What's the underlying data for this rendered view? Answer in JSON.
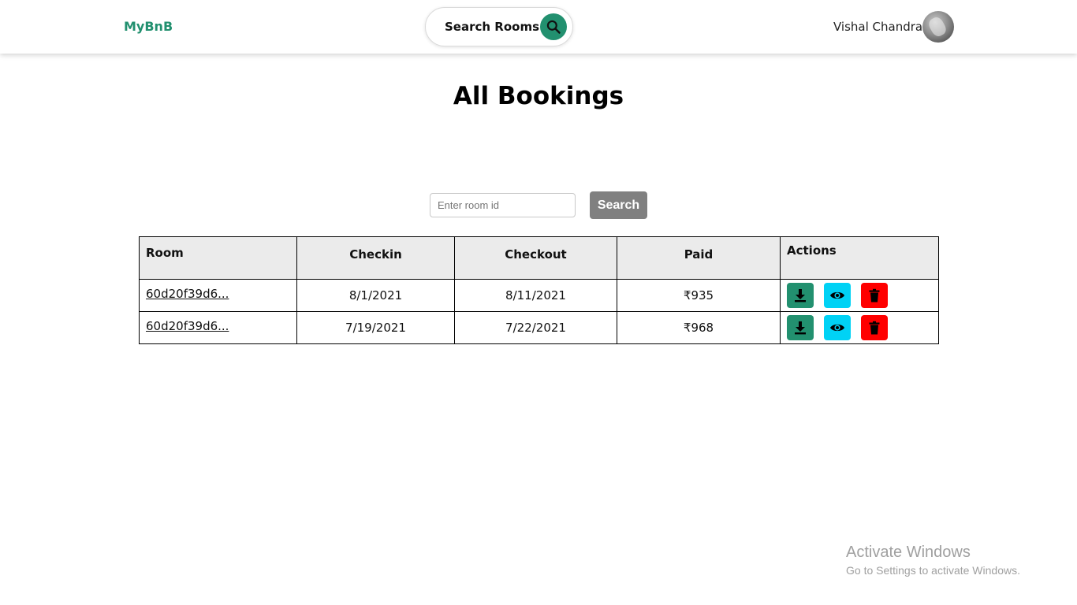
{
  "header": {
    "logo": "MyBnB",
    "search_label": "Search Rooms",
    "user_name": "Vishal Chandra"
  },
  "page": {
    "title": "All Bookings"
  },
  "filter": {
    "placeholder": "Enter room id",
    "value": "",
    "button_label": "Search"
  },
  "table": {
    "columns": [
      "Room",
      "Checkin",
      "Checkout",
      "Paid",
      "Actions"
    ],
    "rows": [
      {
        "room": "60d20f39d6...",
        "checkin": "8/1/2021",
        "checkout": "8/11/2021",
        "paid": "₹935"
      },
      {
        "room": "60d20f39d6...",
        "checkin": "7/19/2021",
        "checkout": "7/22/2021",
        "paid": "₹968"
      }
    ],
    "actions": [
      {
        "icon": "download-icon",
        "color": "#22906f"
      },
      {
        "icon": "eye-icon",
        "color": "#00d2f5"
      },
      {
        "icon": "trash-icon",
        "color": "#ff0000"
      }
    ]
  },
  "colors": {
    "brand": "#22906f",
    "search_button": "#808080",
    "table_header_bg": "#ebebeb"
  },
  "os_overlay": {
    "title": "Activate Windows",
    "subtitle": "Go to Settings to activate Windows."
  }
}
